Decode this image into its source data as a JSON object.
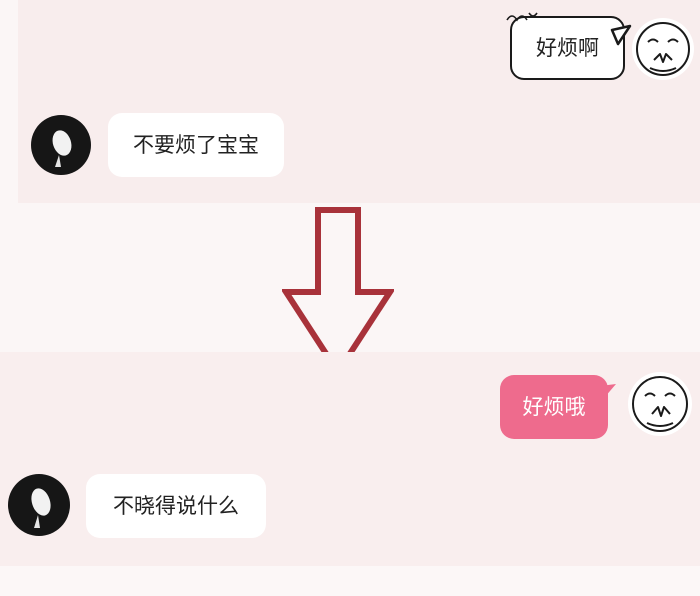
{
  "top": {
    "sent_message": "好烦啊",
    "received_message": "不要烦了宝宝"
  },
  "bottom": {
    "sent_message": "好烦哦",
    "received_message": "不晓得说什么"
  },
  "colors": {
    "sent_bubble_pink": "#ee6b8d",
    "arrow_red": "#a8323a",
    "panel_bg": "#f8eded"
  },
  "icons": {
    "arrow": "down-arrow-icon",
    "avatar_self": "emoji-face-avatar",
    "avatar_other": "dark-avatar"
  }
}
